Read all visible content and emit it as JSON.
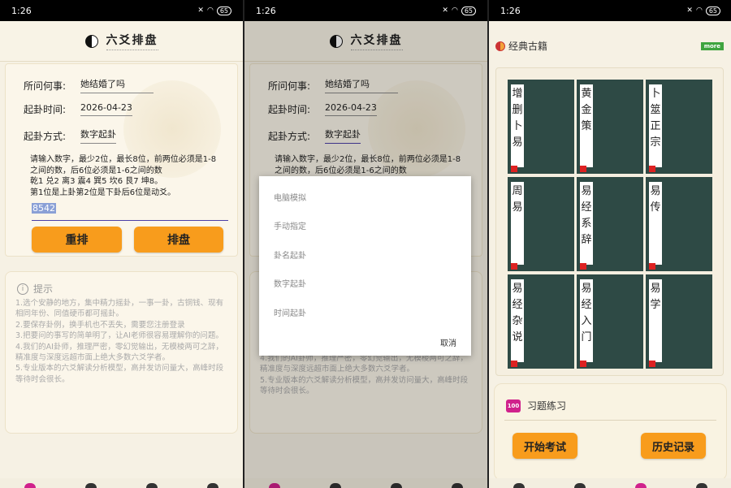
{
  "status": {
    "time": "1:26",
    "battery": "65"
  },
  "header": {
    "title": "六爻排盘"
  },
  "form": {
    "question_label": "所问何事:",
    "question_value": "她结婚了吗",
    "date_label": "起卦时间:",
    "date_value": "2026-04-23",
    "method_label": "起卦方式:",
    "method_value": "数字起卦",
    "hint_lines": [
      "请输入数字，最少2位，最长8位，前两位必须是1-8之间的数，后6位必须是1-6之间的数",
      "乾1 兑2 离3 震4 巽5 坎6 艮7 坤8。",
      "第1位是上卦第2位是下卦后6位是动爻。"
    ],
    "number_value": "8542",
    "reset_label": "重排",
    "cast_label": "排盘"
  },
  "tips": {
    "title": "提示",
    "lines": [
      "1.选个安静的地方，集中精力摇卦，一事一卦，古铜钱、现有相同年份、同值硬币都可摇卦。",
      "2.要保存卦例，换手机也不丢失，需要您注册登录",
      "3.把要问的事写的简单明了，让AI老师很容易理解你的问题。",
      "4.我们的AI卦师，推理严密，零幻觉输出，无模棱两可之辞，精准度与深度远超市面上绝大多数六爻学者。",
      "5.专业版本的六爻解读分析模型，高并发访问量大，高峰时段等待时会很长。"
    ]
  },
  "dialog": {
    "options": [
      "电脑模拟",
      "手动指定",
      "卦名起卦",
      "数字起卦",
      "时间起卦"
    ],
    "cancel_label": "取消"
  },
  "books": {
    "title": "经典古籍",
    "more_label": "more",
    "items": [
      "增删卜易",
      "黄金策",
      "卜筮正宗",
      "周易",
      "易经系辞",
      "易传",
      "易经杂说",
      "易经入门",
      "易学"
    ]
  },
  "exam": {
    "icon_text": "100",
    "title": "习题练习",
    "start_label": "开始考试",
    "history_label": "历史记录"
  }
}
